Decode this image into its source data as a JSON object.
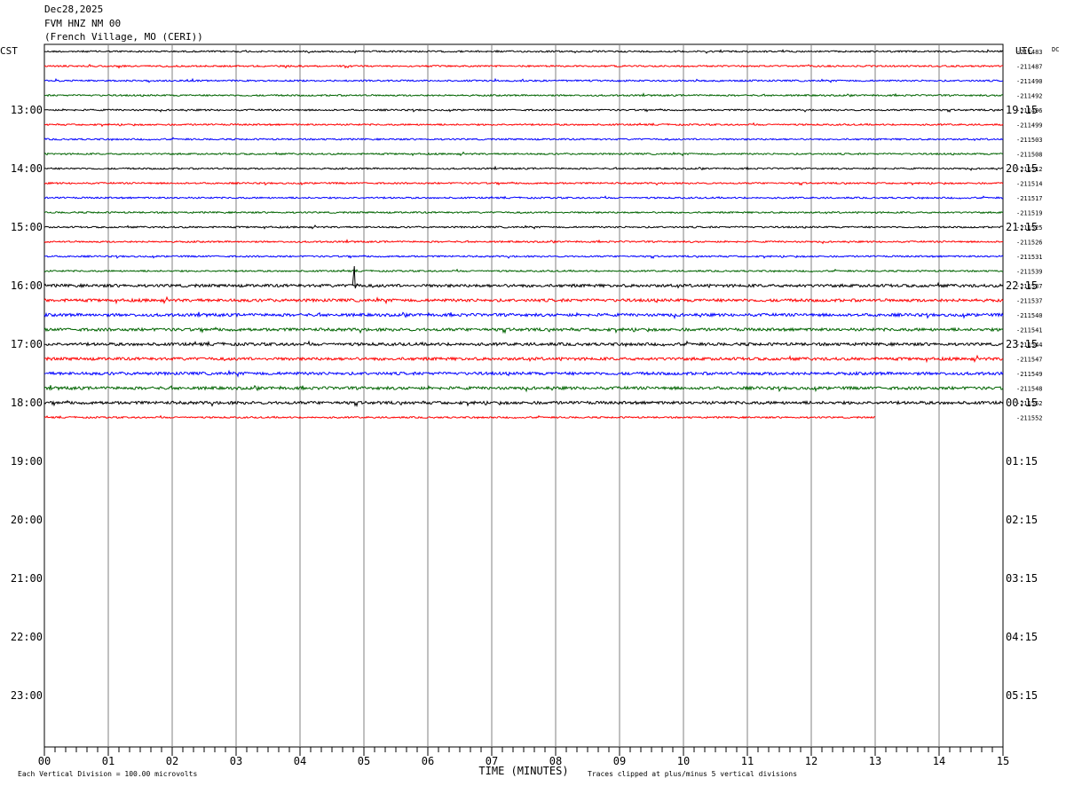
{
  "header": {
    "date": "Dec28,2025",
    "station": "FVM HNZ NM 00",
    "location": "(French Village, MO (CERI))"
  },
  "chart_data": {
    "type": "line",
    "title": "Dec28,2025",
    "left_label": "CST",
    "right_label": "UTC",
    "dc_label": "DC",
    "xlabel": "TIME (MINUTES)",
    "x_ticks": [
      "00",
      "01",
      "02",
      "03",
      "04",
      "05",
      "06",
      "07",
      "08",
      "09",
      "10",
      "11",
      "12",
      "13",
      "14",
      "15"
    ],
    "xlim": [
      0,
      15
    ],
    "left_hours": [
      "13:00",
      "14:00",
      "15:00",
      "16:00",
      "17:00",
      "18:00",
      "19:00",
      "20:00",
      "21:00",
      "22:00",
      "23:00"
    ],
    "right_hours": [
      "19:15",
      "20:15",
      "21:15",
      "22:15",
      "23:15",
      "00:15",
      "01:15",
      "02:15",
      "03:15",
      "04:15",
      "05:15"
    ],
    "rows_per_hour": 4,
    "trace_colors": [
      "#000000",
      "#ff0000",
      "#0000ff",
      "#006400"
    ],
    "dc_offsets": [
      "211483",
      "211487",
      "211490",
      "211492",
      "211496",
      "211499",
      "211503",
      "211508",
      "211512",
      "211514",
      "211517",
      "211519",
      "211525",
      "211526",
      "211531",
      "211539",
      "211537",
      "211537",
      "211540",
      "211541",
      "211544",
      "211547",
      "211549",
      "211548",
      "211552",
      "211552"
    ],
    "traces_count": 26,
    "last_trace_end_minute": 13,
    "event": {
      "trace_index": 16,
      "minute": 4.85
    },
    "footer_left": "Each Vertical Division =  100.00 microvolts",
    "footer_right": "Traces clipped at plus/minus 5 vertical divisions"
  }
}
